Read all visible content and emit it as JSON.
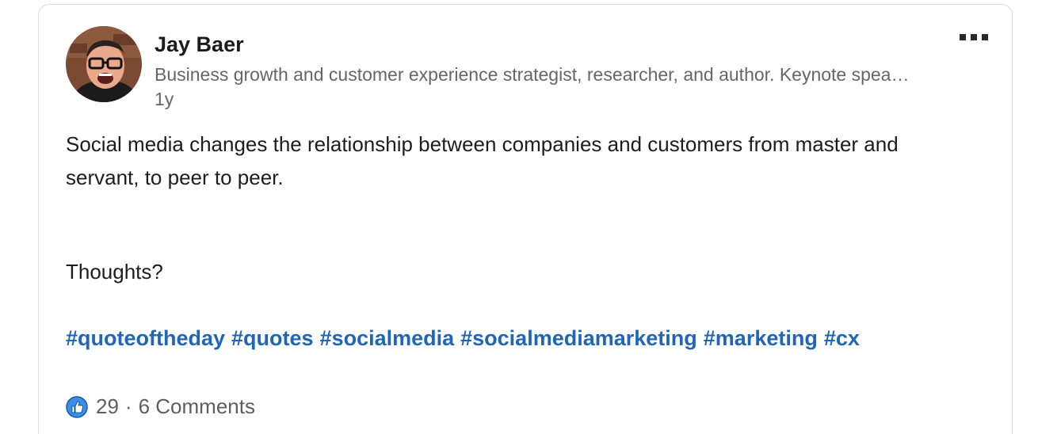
{
  "post": {
    "author": {
      "name": "Jay Baer",
      "headline": "Business growth and customer experience strategist, researcher, and author. Keynote spea…",
      "age": "1y",
      "avatar_icon": "profile-photo"
    },
    "menu_icon": "more-options-icon",
    "body": {
      "text": "Social media changes the relationship between companies and customers from master and servant, to peer to peer.",
      "question": "Thoughts?"
    },
    "hashtags": [
      "#quoteoftheday",
      "#quotes",
      "#socialmedia",
      "#socialmediamarketing",
      "#marketing",
      "#cx"
    ],
    "social": {
      "reaction_icon": "like-icon",
      "reactions": "29",
      "separator": "·",
      "comments": "6 Comments"
    }
  },
  "colors": {
    "hashtag": "#1f65b8",
    "secondary_text": "#666666",
    "like_blue": "#378fe9"
  }
}
